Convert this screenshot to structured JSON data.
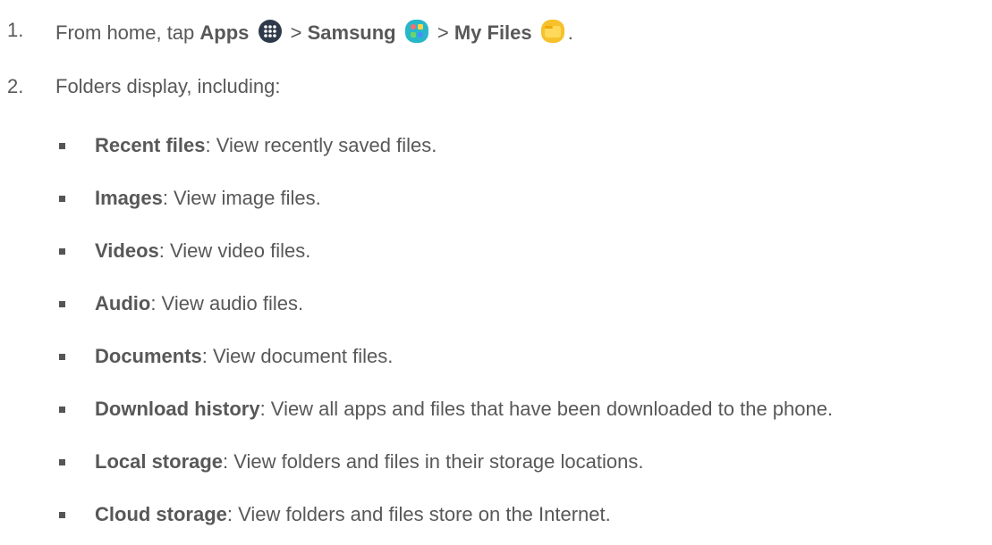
{
  "steps": [
    {
      "number": "1.",
      "prefix": "From home, tap ",
      "apps": "Apps",
      "sep1": " > ",
      "samsung": "Samsung",
      "sep2": " > ",
      "myfiles": "My Files",
      "end": ".",
      "icons": [
        "apps-grid-icon",
        "samsung-folder-icon",
        "my-files-folder-icon"
      ]
    },
    {
      "number": "2.",
      "text": "Folders display, including:"
    }
  ],
  "items": [
    {
      "term": "Recent files",
      "desc": ": View recently saved files."
    },
    {
      "term": "Images",
      "desc": ": View image files."
    },
    {
      "term": "Videos",
      "desc": ": View video files."
    },
    {
      "term": "Audio",
      "desc": ": View audio files."
    },
    {
      "term": "Documents",
      "desc": ": View document files."
    },
    {
      "term": "Download history",
      "desc": ": View all apps and files that have been downloaded to the phone."
    },
    {
      "term": "Local storage",
      "desc": ": View folders and files in their storage locations."
    },
    {
      "term": "Cloud storage",
      "desc": ": View folders and files store on the Internet."
    }
  ],
  "colors": {
    "text": "#585858",
    "apps_icon": "#2e3a4a",
    "samsung_icon": "#27b7c9",
    "myfiles_icon": "#f6c12b"
  }
}
